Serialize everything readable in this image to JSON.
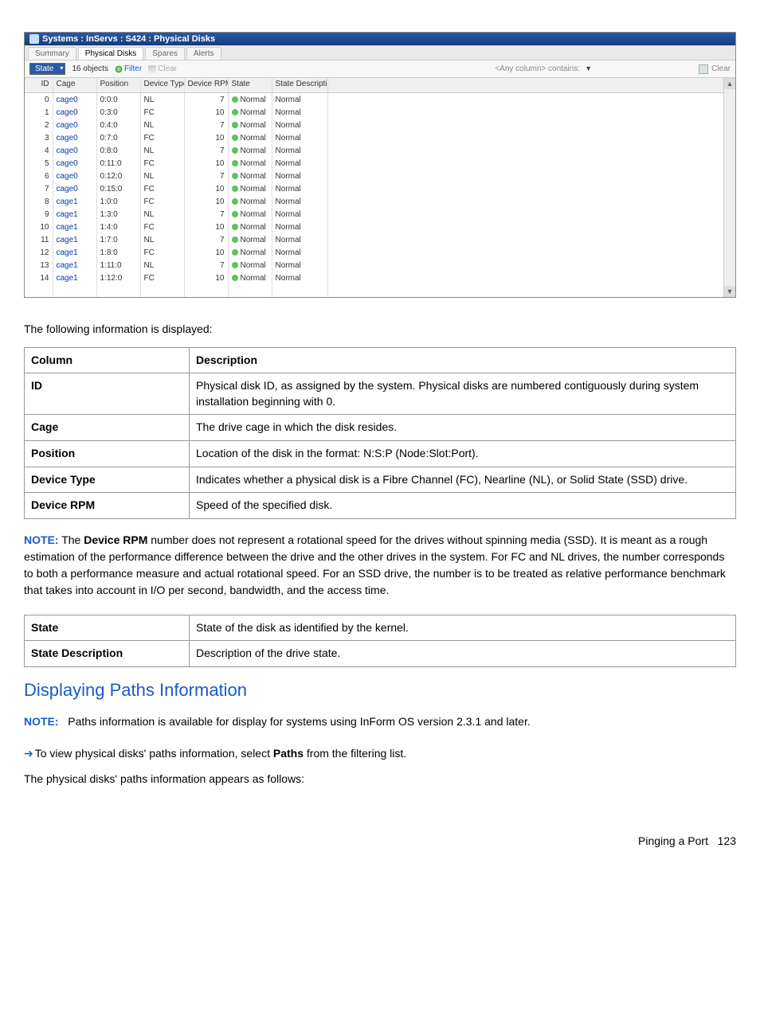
{
  "app": {
    "title": "Systems : InServs : S424 : Physical Disks",
    "tabs": [
      "Summary",
      "Physical Disks",
      "Spares",
      "Alerts"
    ],
    "active_tab_index": 1,
    "toolbar": {
      "select_label": "State",
      "count_label": "16 objects",
      "filter_label": "Filter",
      "clear_label": "Clear",
      "search_placeholder": "<Any column> contains:",
      "clear2_label": "Clear"
    },
    "columns": [
      "ID",
      "Cage",
      "Position",
      "Device Type",
      "Device RPM (K)",
      "State",
      "State Description"
    ],
    "rows": [
      {
        "id": "0",
        "cage": "cage0",
        "pos": "0:0:0",
        "dtype": "NL",
        "rpm": "7",
        "state": "Normal",
        "desc": "Normal"
      },
      {
        "id": "1",
        "cage": "cage0",
        "pos": "0:3:0",
        "dtype": "FC",
        "rpm": "10",
        "state": "Normal",
        "desc": "Normal"
      },
      {
        "id": "2",
        "cage": "cage0",
        "pos": "0:4:0",
        "dtype": "NL",
        "rpm": "7",
        "state": "Normal",
        "desc": "Normal"
      },
      {
        "id": "3",
        "cage": "cage0",
        "pos": "0:7:0",
        "dtype": "FC",
        "rpm": "10",
        "state": "Normal",
        "desc": "Normal"
      },
      {
        "id": "4",
        "cage": "cage0",
        "pos": "0:8:0",
        "dtype": "NL",
        "rpm": "7",
        "state": "Normal",
        "desc": "Normal"
      },
      {
        "id": "5",
        "cage": "cage0",
        "pos": "0:11:0",
        "dtype": "FC",
        "rpm": "10",
        "state": "Normal",
        "desc": "Normal"
      },
      {
        "id": "6",
        "cage": "cage0",
        "pos": "0:12:0",
        "dtype": "NL",
        "rpm": "7",
        "state": "Normal",
        "desc": "Normal"
      },
      {
        "id": "7",
        "cage": "cage0",
        "pos": "0:15:0",
        "dtype": "FC",
        "rpm": "10",
        "state": "Normal",
        "desc": "Normal"
      },
      {
        "id": "8",
        "cage": "cage1",
        "pos": "1:0:0",
        "dtype": "FC",
        "rpm": "10",
        "state": "Normal",
        "desc": "Normal"
      },
      {
        "id": "9",
        "cage": "cage1",
        "pos": "1:3:0",
        "dtype": "NL",
        "rpm": "7",
        "state": "Normal",
        "desc": "Normal"
      },
      {
        "id": "10",
        "cage": "cage1",
        "pos": "1:4:0",
        "dtype": "FC",
        "rpm": "10",
        "state": "Normal",
        "desc": "Normal"
      },
      {
        "id": "11",
        "cage": "cage1",
        "pos": "1:7:0",
        "dtype": "NL",
        "rpm": "7",
        "state": "Normal",
        "desc": "Normal"
      },
      {
        "id": "12",
        "cage": "cage1",
        "pos": "1:8:0",
        "dtype": "FC",
        "rpm": "10",
        "state": "Normal",
        "desc": "Normal"
      },
      {
        "id": "13",
        "cage": "cage1",
        "pos": "1:11:0",
        "dtype": "NL",
        "rpm": "7",
        "state": "Normal",
        "desc": "Normal"
      },
      {
        "id": "14",
        "cage": "cage1",
        "pos": "1:12:0",
        "dtype": "FC",
        "rpm": "10",
        "state": "Normal",
        "desc": "Normal"
      }
    ]
  },
  "intro_text": "The following information is displayed:",
  "desc_table": {
    "head": [
      "Column",
      "Description"
    ],
    "rows": [
      {
        "name": "ID",
        "desc": "Physical disk ID, as assigned by the system. Physical disks are numbered contiguously during system installation beginning with 0."
      },
      {
        "name": "Cage",
        "desc": "The drive cage in which the disk resides."
      },
      {
        "name": "Position",
        "desc": "Location of the disk in the format: N:S:P (Node:Slot:Port)."
      },
      {
        "name": "Device Type",
        "desc": "Indicates whether a physical disk is a Fibre Channel (FC), Nearline (NL), or Solid State (SSD) drive."
      },
      {
        "name": "Device RPM",
        "desc": "Speed of the specified disk."
      }
    ],
    "rows2": [
      {
        "name": "State",
        "desc": "State of the disk as identified by the kernel."
      },
      {
        "name": "State Description",
        "desc": "Description of the drive state."
      }
    ]
  },
  "note1": {
    "label": "NOTE:",
    "prefix": "The ",
    "bold": "Device RPM",
    "rest": " number does not represent a rotational speed for the drives without spinning media (SSD). It is meant as a rough estimation of the performance difference between the drive and the other drives in the system. For FC and NL drives, the number corresponds to both a performance measure and actual rotational speed. For an SSD drive, the number is to be treated as relative performance benchmark that takes into account in I/O per second, bandwidth, and the access time."
  },
  "section_heading": "Displaying Paths Information",
  "note2": {
    "label": "NOTE:",
    "text": "Paths information is available for display for systems using InForm OS version 2.3.1 and later."
  },
  "step": {
    "pre": "To view physical disks' paths information, select ",
    "bold": "Paths",
    "post": " from the filtering list."
  },
  "after_step": "The physical disks' paths information appears as follows:",
  "footer": {
    "text": "Pinging a Port",
    "page": "123"
  }
}
